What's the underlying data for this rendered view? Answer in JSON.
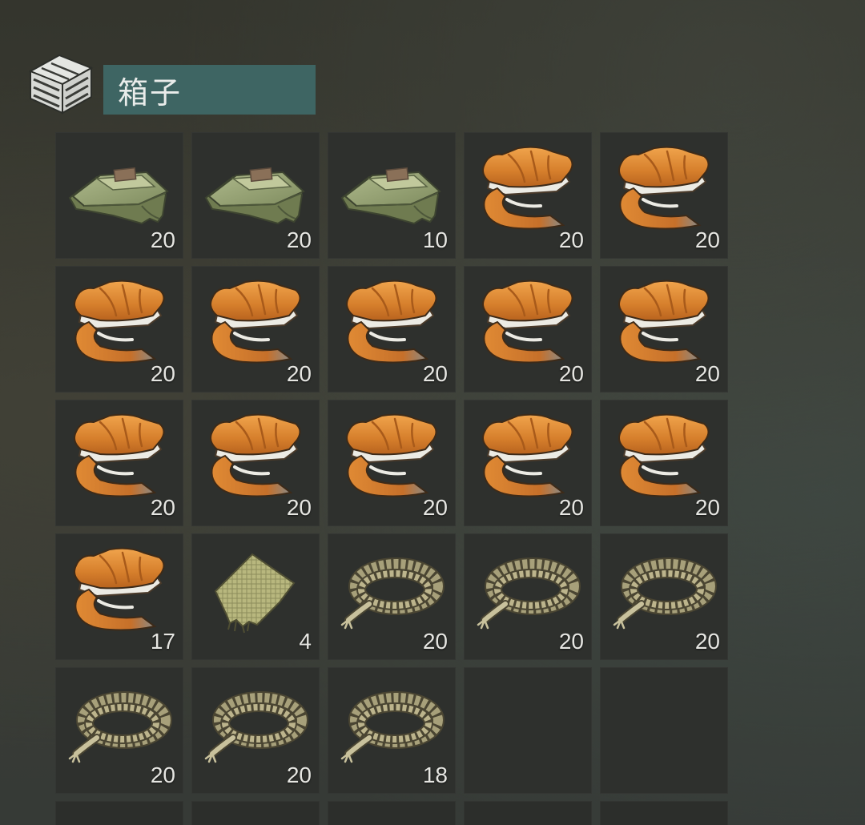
{
  "container": {
    "title": "箱子",
    "icon": "crate-icon"
  },
  "colors": {
    "title_bar": "#3e6563",
    "slot_bg": "#2e302d",
    "quantity_text": "#e6e6e2"
  },
  "inventory": {
    "columns": 5,
    "slots": [
      {
        "item": "cloth",
        "icon": "cloth-icon",
        "quantity": "20"
      },
      {
        "item": "cloth",
        "icon": "cloth-icon",
        "quantity": "20"
      },
      {
        "item": "cloth",
        "icon": "cloth-icon",
        "quantity": "10"
      },
      {
        "item": "fox-fur",
        "icon": "fox-fur-icon",
        "quantity": "20"
      },
      {
        "item": "fox-fur",
        "icon": "fox-fur-icon",
        "quantity": "20"
      },
      {
        "item": "fox-fur",
        "icon": "fox-fur-icon",
        "quantity": "20"
      },
      {
        "item": "fox-fur",
        "icon": "fox-fur-icon",
        "quantity": "20"
      },
      {
        "item": "fox-fur",
        "icon": "fox-fur-icon",
        "quantity": "20"
      },
      {
        "item": "fox-fur",
        "icon": "fox-fur-icon",
        "quantity": "20"
      },
      {
        "item": "fox-fur",
        "icon": "fox-fur-icon",
        "quantity": "20"
      },
      {
        "item": "fox-fur",
        "icon": "fox-fur-icon",
        "quantity": "20"
      },
      {
        "item": "fox-fur",
        "icon": "fox-fur-icon",
        "quantity": "20"
      },
      {
        "item": "fox-fur",
        "icon": "fox-fur-icon",
        "quantity": "20"
      },
      {
        "item": "fox-fur",
        "icon": "fox-fur-icon",
        "quantity": "20"
      },
      {
        "item": "fox-fur",
        "icon": "fox-fur-icon",
        "quantity": "20"
      },
      {
        "item": "fox-fur",
        "icon": "fox-fur-icon",
        "quantity": "17"
      },
      {
        "item": "burlap-scrap",
        "icon": "burlap-scrap-icon",
        "quantity": "4"
      },
      {
        "item": "rope",
        "icon": "rope-icon",
        "quantity": "20"
      },
      {
        "item": "rope",
        "icon": "rope-icon",
        "quantity": "20"
      },
      {
        "item": "rope",
        "icon": "rope-icon",
        "quantity": "20"
      },
      {
        "item": "rope",
        "icon": "rope-icon",
        "quantity": "20"
      },
      {
        "item": "rope",
        "icon": "rope-icon",
        "quantity": "20"
      },
      {
        "item": "rope",
        "icon": "rope-icon",
        "quantity": "18"
      },
      {
        "item": "",
        "icon": "",
        "quantity": ""
      },
      {
        "item": "",
        "icon": "",
        "quantity": ""
      }
    ]
  }
}
